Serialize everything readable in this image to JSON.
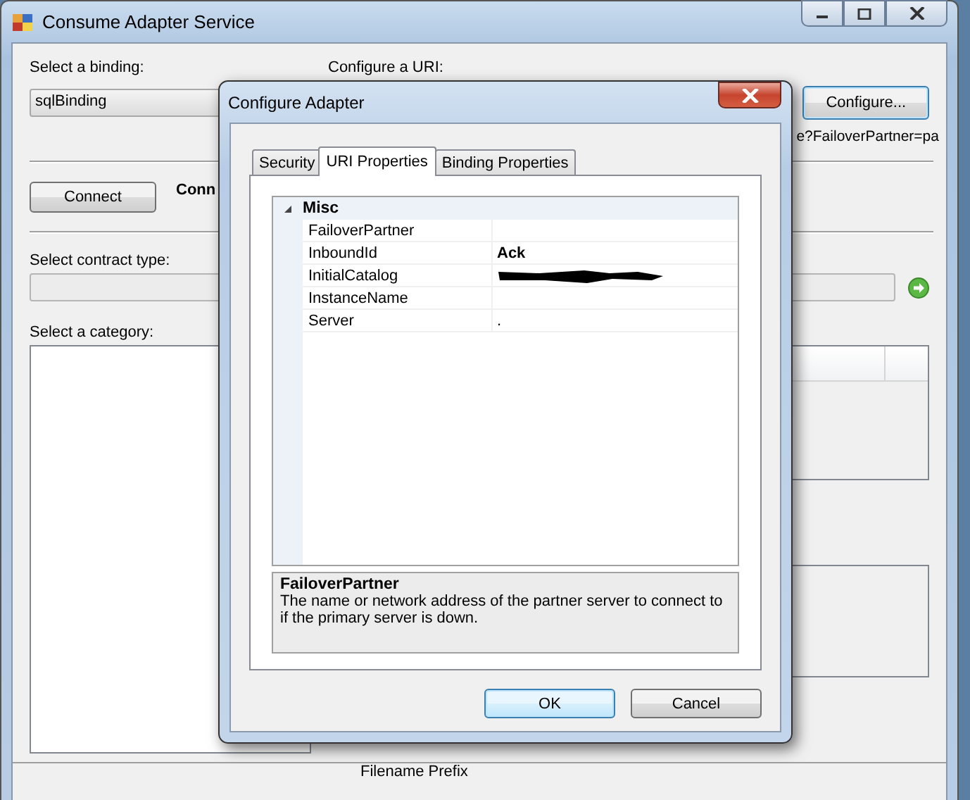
{
  "window": {
    "title": "Consume Adapter Service"
  },
  "binding": {
    "label": "Select a binding:",
    "value": "sqlBinding"
  },
  "uri": {
    "label": "Configure a URI:",
    "configure_button": "Configure...",
    "uri_text": "e?FailoverPartner=pa"
  },
  "connect": {
    "button": "Connect",
    "status": "Conn"
  },
  "contract": {
    "label": "Select contract type:"
  },
  "category": {
    "label": "Select a category:"
  },
  "footer": {
    "label": "Filename Prefix"
  },
  "dialog": {
    "title": "Configure Adapter",
    "tabs": [
      {
        "label": "Security",
        "selected": false
      },
      {
        "label": "URI Properties",
        "selected": true
      },
      {
        "label": "Binding Properties",
        "selected": false
      }
    ],
    "property_grid": {
      "category": {
        "label": "Misc",
        "expanded": true
      },
      "properties": [
        {
          "name": "FailoverPartner",
          "kind": "text",
          "modified": false
        },
        {
          "name": "InboundId",
          "kind": "text",
          "value": "Ack",
          "modified": true
        },
        {
          "name": "InitialCatalog",
          "kind": "redacted",
          "modified": false
        },
        {
          "name": "InstanceName",
          "kind": "text",
          "modified": false
        },
        {
          "name": "Server",
          "kind": "text",
          "value": ".",
          "modified": false
        }
      ]
    },
    "description": {
      "title": "FailoverPartner",
      "text": "The name or network address of the partner server to connect to if the primary server is down."
    },
    "buttons": [
      {
        "label": "OK",
        "default": true
      },
      {
        "label": "Cancel",
        "default": false
      }
    ]
  }
}
